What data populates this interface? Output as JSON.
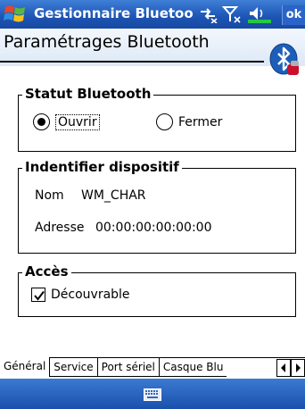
{
  "titlebar": {
    "title": "Gestionnaire Bluetoo",
    "ok_label": "ok",
    "icons": [
      "windows-flag-icon",
      "connectivity-icon",
      "signal-icon",
      "volume-icon"
    ]
  },
  "header": {
    "title": "Paramétrages Bluetooth",
    "icon": "bluetooth-icon"
  },
  "status_group": {
    "title": "Statut Bluetooth",
    "options": [
      {
        "label": "Ouvrir",
        "selected": true
      },
      {
        "label": "Fermer",
        "selected": false
      }
    ]
  },
  "device_group": {
    "title": "Indentifier dispositif",
    "name_label": "Nom",
    "name_value": "WM_CHAR",
    "address_label": "Adresse",
    "address_value": "00:00:00:00:00:00"
  },
  "access_group": {
    "title": "Accès",
    "discoverable_label": "Découvrable",
    "discoverable_checked": true
  },
  "tabs": [
    {
      "label": "Général",
      "active": true
    },
    {
      "label": "Service",
      "active": false
    },
    {
      "label": "Port sériel",
      "active": false
    },
    {
      "label": "Casque Blu",
      "active": false
    }
  ],
  "bottombar": {
    "icon": "keyboard-icon"
  }
}
